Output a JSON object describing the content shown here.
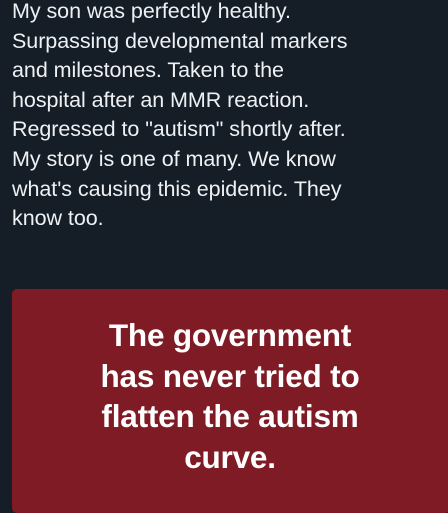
{
  "post": {
    "text_lines": [
      "My son was perfectly healthy.",
      "Surpassing developmental markers",
      "and milestones. Taken to the",
      "hospital after an MMR reaction.",
      "Regressed to \"autism\" shortly after.",
      "My story is one of many. We know",
      "what's causing this epidemic. They",
      "know too."
    ]
  },
  "quote_card": {
    "background_color": "#7f1b24",
    "text_lines": [
      "The government",
      "has never tried to",
      "flatten the autism",
      "curve."
    ]
  },
  "colors": {
    "page_background": "#151d27",
    "post_text": "#eef1f4",
    "card_text": "#ffffff"
  }
}
